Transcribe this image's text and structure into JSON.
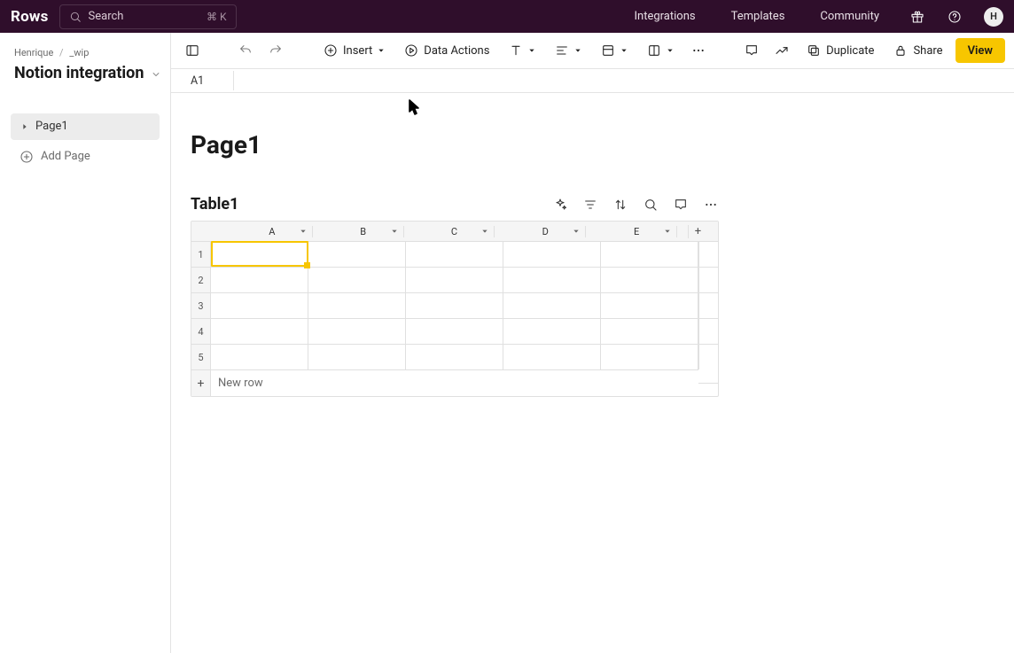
{
  "header": {
    "logo": "Rows",
    "search_placeholder": "Search",
    "search_shortcut": "⌘ K",
    "links": [
      "Integrations",
      "Templates",
      "Community"
    ],
    "avatar_initial": "H"
  },
  "sidebar": {
    "breadcrumb_owner": "Henrique",
    "breadcrumb_folder": "_wip",
    "doc_title": "Notion integration",
    "pages": [
      {
        "label": "Page1",
        "active": true
      }
    ],
    "add_page_label": "Add Page"
  },
  "toolbar": {
    "insert_label": "Insert",
    "data_actions_label": "Data Actions",
    "duplicate_label": "Duplicate",
    "share_label": "Share",
    "view_label": "View"
  },
  "formula_bar": {
    "cell_ref": "A1",
    "value": ""
  },
  "document": {
    "page_title": "Page1",
    "tables": [
      {
        "title": "Table1",
        "columns": [
          "A",
          "B",
          "C",
          "D",
          "E"
        ],
        "row_count": 5,
        "new_row_label": "New row",
        "selected_cell": "A1"
      }
    ]
  }
}
